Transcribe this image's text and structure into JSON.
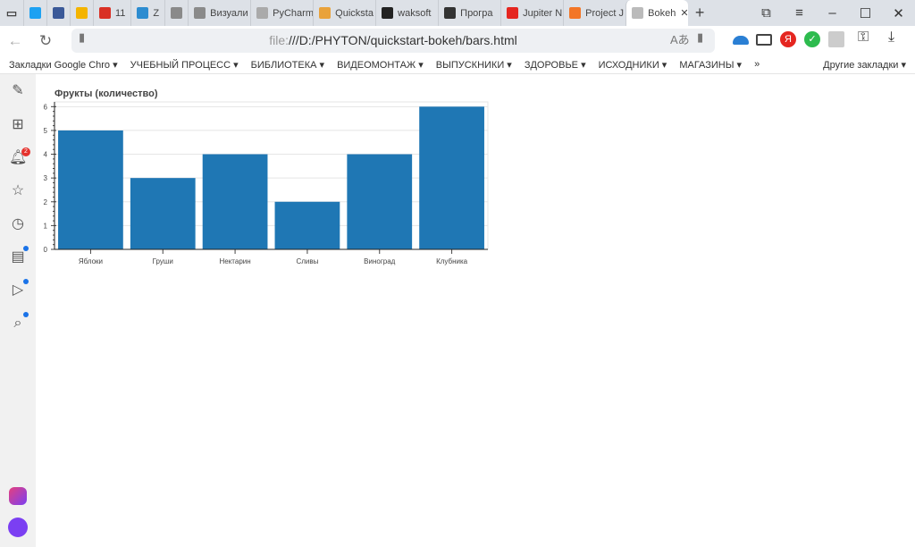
{
  "tabs": [
    {
      "label": "",
      "icon": "twitter-icon",
      "color": "#1da1f2"
    },
    {
      "label": "",
      "icon": "facebook-icon",
      "color": "#3b5998"
    },
    {
      "label": "",
      "icon": "mail-icon",
      "color": "#f4b400"
    },
    {
      "label": "11",
      "icon": "gmail-icon",
      "color": "#d93025"
    },
    {
      "label": "Z",
      "icon": "z-icon",
      "color": "#2d8cd0"
    },
    {
      "label": "",
      "icon": "python-icon",
      "color": "#8a8a8a"
    },
    {
      "label": "Визуали",
      "icon": "python-icon",
      "color": "#8a8a8a"
    },
    {
      "label": "PyCharm",
      "icon": "pycharm-icon",
      "color": "#aaaaaa"
    },
    {
      "label": "Quicksta",
      "icon": "quickstart-icon",
      "color": "#e9a23b"
    },
    {
      "label": "waksoft",
      "icon": "github-icon",
      "color": "#222222"
    },
    {
      "label": "Програ",
      "icon": "monitor-icon",
      "color": "#333333"
    },
    {
      "label": "Jupiter N",
      "icon": "yandex-icon",
      "color": "#e52620"
    },
    {
      "label": "Project J",
      "icon": "jupyter-icon",
      "color": "#f37626"
    },
    {
      "label": "Bokeh",
      "icon": "file-icon",
      "color": "#bbbbbb"
    }
  ],
  "address": {
    "prefix": "file:",
    "url": "///D:/PHYTON/quickstart-bokeh/bars.html"
  },
  "bookmarks": [
    "Закладки Google Chro",
    "УЧЕБНЫЙ ПРОЦЕСС",
    "БИБЛИОТЕКА",
    "ВИДЕОМОНТАЖ",
    "ВЫПУСКНИКИ",
    "ЗДОРОВЬЕ",
    "ИСХОДНИКИ",
    "МАГАЗИНЫ"
  ],
  "bookmarks_more": "»",
  "other_bookmarks": "Другие закладки",
  "notification_badge": "2",
  "chart_data": {
    "type": "bar",
    "title": "Фрукты (количество)",
    "categories": [
      "Яблоки",
      "Груши",
      "Нектарин",
      "Сливы",
      "Виноград",
      "Клубника"
    ],
    "values": [
      5,
      3,
      4,
      2,
      4,
      6
    ],
    "ylim": [
      0,
      6.2
    ],
    "yticks": [
      0,
      1,
      2,
      3,
      4,
      5,
      6
    ],
    "grid": true,
    "bar_color": "#1f77b4"
  }
}
